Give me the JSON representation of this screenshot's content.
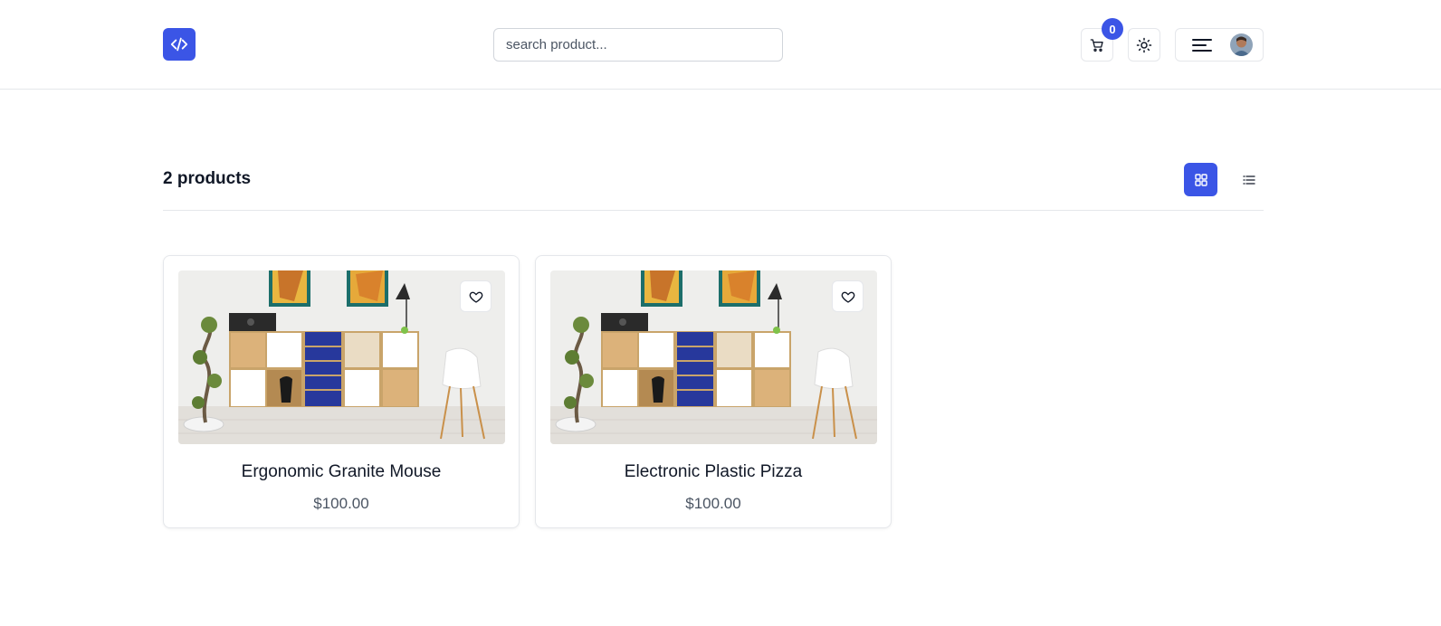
{
  "header": {
    "logo_icon": "code-icon",
    "search_placeholder": "search product...",
    "cart_count": "0",
    "accent_color": "#3b55e6"
  },
  "listing": {
    "count_label": "2 products",
    "view_mode": "grid"
  },
  "products": [
    {
      "title": "Ergonomic Granite Mouse",
      "price": "$100.00"
    },
    {
      "title": "Electronic Plastic Pizza",
      "price": "$100.00"
    }
  ]
}
